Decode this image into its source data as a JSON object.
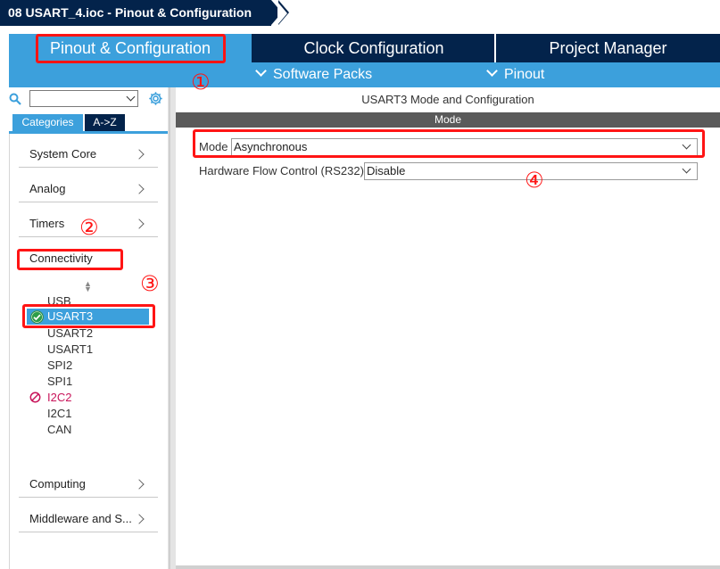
{
  "breadcrumb": {
    "title": "08 USART_4.ioc - Pinout & Configuration"
  },
  "tabs": [
    {
      "label": "Pinout & Configuration"
    },
    {
      "label": "Clock Configuration"
    },
    {
      "label": "Project Manager"
    }
  ],
  "subbar": {
    "software_packs": "Software Packs",
    "pinout": "Pinout"
  },
  "left": {
    "search_placeholder": "",
    "category_tabs": [
      "Categories",
      "A->Z"
    ],
    "categories": [
      "System Core",
      "Analog",
      "Timers",
      "Connectivity",
      "Computing",
      "Middleware and S..."
    ],
    "peripherals": [
      "USB",
      "USART3",
      "USART2",
      "USART1",
      "SPI2",
      "SPI1",
      "I2C2",
      "I2C1",
      "CAN"
    ]
  },
  "right": {
    "title": "USART3 Mode and Configuration",
    "mode_header": "Mode",
    "mode_label": "Mode",
    "mode_value": "Asynchronous",
    "flow_label": "Hardware Flow Control (RS232)",
    "flow_value": "Disable"
  },
  "annotations": [
    "①",
    "②",
    "③",
    "④"
  ],
  "colors": {
    "navy": "#03234b",
    "accent": "#3ca0dc",
    "highlight": "#ff1414",
    "warn": "#c8145a"
  }
}
